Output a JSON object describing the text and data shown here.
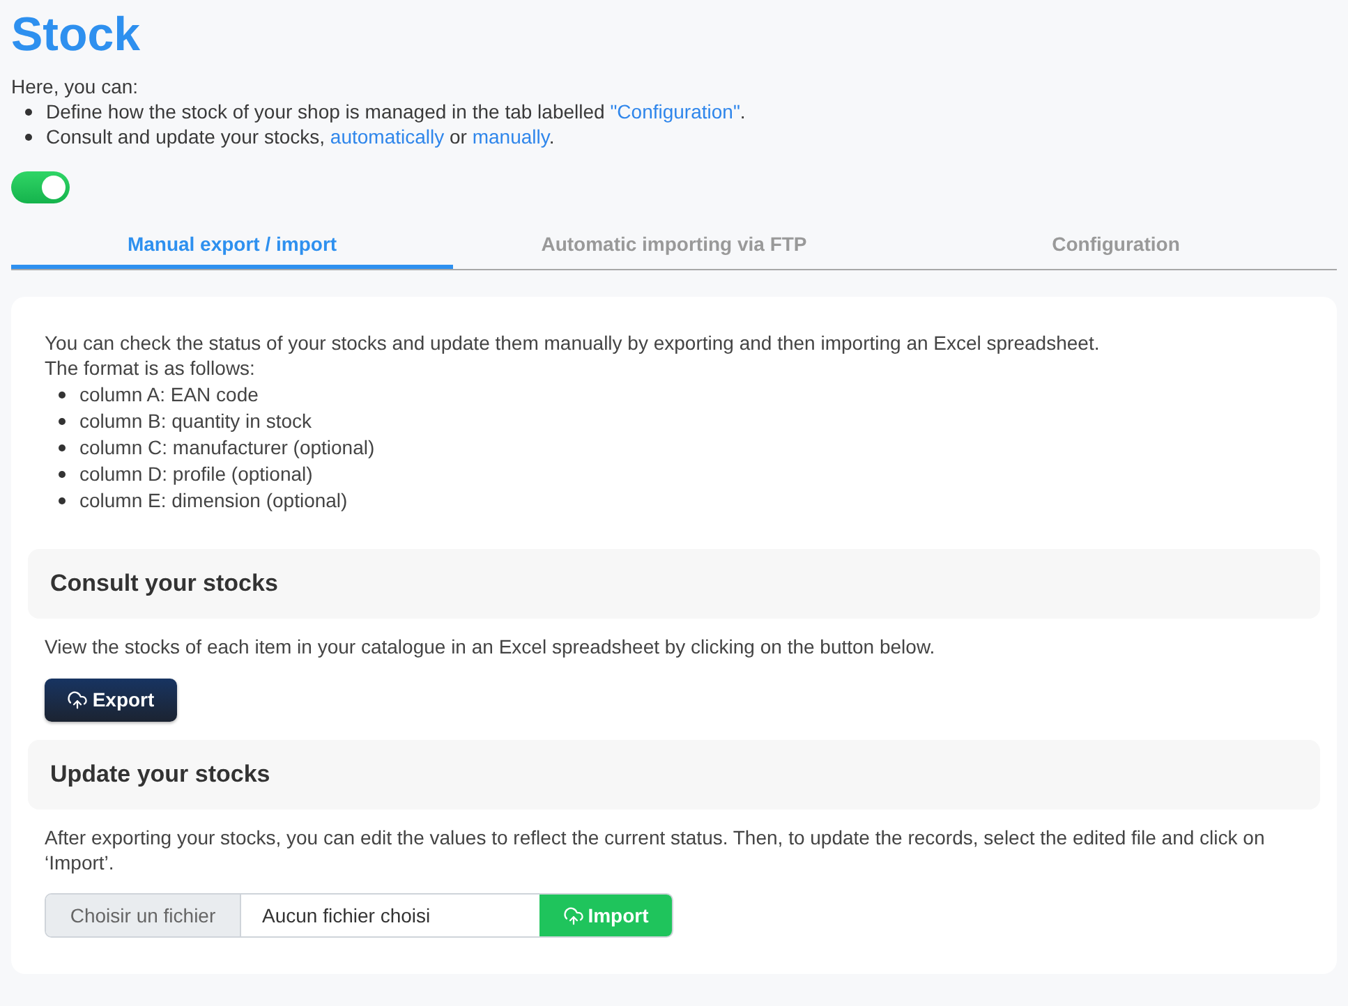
{
  "page": {
    "title": "Stock"
  },
  "intro": {
    "lead": "Here, you can:",
    "items": [
      {
        "segments": [
          {
            "kind": "text",
            "text": "Define how the stock of your shop is managed in the tab labelled "
          },
          {
            "kind": "link",
            "text": "\"Configuration\""
          },
          {
            "kind": "text",
            "text": "."
          }
        ]
      },
      {
        "segments": [
          {
            "kind": "text",
            "text": "Consult and update your stocks, "
          },
          {
            "kind": "link",
            "text": "automatically"
          },
          {
            "kind": "text",
            "text": " or "
          },
          {
            "kind": "link",
            "text": "manually"
          },
          {
            "kind": "text",
            "text": "."
          }
        ]
      }
    ]
  },
  "toggle": {
    "on": true
  },
  "tabs": [
    {
      "label": "Manual export / import",
      "selected": true
    },
    {
      "label": "Automatic importing via FTP",
      "selected": false
    },
    {
      "label": "Configuration",
      "selected": false
    }
  ],
  "panel": {
    "description": "You can check the status of your stocks and update them manually by exporting and then importing an Excel spreadsheet.",
    "format_lead": "The format is as follows:",
    "format_items": [
      "column A: EAN code",
      "column B: quantity in stock",
      "column C: manufacturer (optional)",
      "column D: profile (optional)",
      "column E: dimension (optional)"
    ],
    "sections": [
      {
        "kind": "export",
        "heading": "Consult your stocks",
        "text": "View the stocks of each item in your catalogue in an Excel spreadsheet by clicking on the button below.",
        "button": "Export"
      },
      {
        "kind": "import",
        "heading": "Update your stocks",
        "text": "After exporting your stocks, you can edit the values to reflect the current status. Then, to update the records, select the edited file and click on ‘Import’.",
        "file_button": "Choisir un fichier",
        "file_status": "Aucun fichier choisi",
        "button": "Import"
      }
    ]
  }
}
